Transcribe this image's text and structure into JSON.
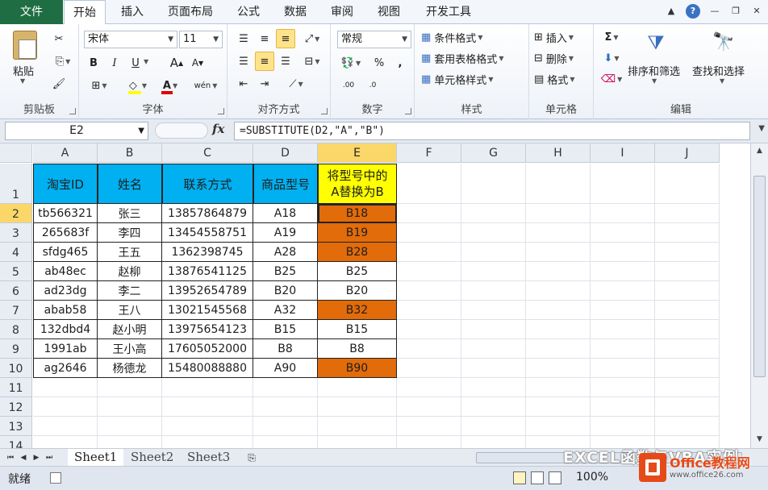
{
  "ribbon_tabs": [
    "文件",
    "开始",
    "插入",
    "页面布局",
    "公式",
    "数据",
    "审阅",
    "视图",
    "开发工具"
  ],
  "active_tab": "开始",
  "clipboard": {
    "paste": "粘贴",
    "label": "剪贴板"
  },
  "font": {
    "name": "宋体",
    "size": "11",
    "label": "字体",
    "bold": "B",
    "italic": "I",
    "underline": "U",
    "grow": "A",
    "shrink": "A",
    "fill_color": "#ffff00",
    "font_color": "#e00000",
    "phonetic": "wén"
  },
  "alignment": {
    "label": "对齐方式"
  },
  "number": {
    "format": "常规",
    "label": "数字",
    "percent": "%",
    "comma": ","
  },
  "styles": {
    "conditional": "条件格式",
    "table": "套用表格格式",
    "cell": "单元格样式",
    "label": "样式"
  },
  "cells": {
    "insert": "插入",
    "delete": "删除",
    "format": "格式",
    "label": "单元格"
  },
  "editing": {
    "sigma": "Σ",
    "sort": "排序和筛选",
    "find": "查找和选择",
    "label": "编辑"
  },
  "formula_bar": {
    "name_box": "E2",
    "fx": "fx",
    "formula": "=SUBSTITUTE(D2,\"A\",\"B\")"
  },
  "columns": [
    "A",
    "B",
    "C",
    "D",
    "E",
    "F",
    "G",
    "H",
    "I",
    "J"
  ],
  "active_col": "E",
  "rows": [
    "1",
    "2",
    "3",
    "4",
    "5",
    "6",
    "7",
    "8",
    "9",
    "10",
    "11",
    "12",
    "13",
    "14"
  ],
  "active_row": "2",
  "table": {
    "headers": [
      "淘宝ID",
      "姓名",
      "联系方式",
      "商品型号"
    ],
    "e_header": [
      "将型号中的",
      "A替换为B"
    ],
    "data": [
      [
        "tb566321",
        "张三",
        "13857864879",
        "A18",
        "B18"
      ],
      [
        "265683f",
        "李四",
        "13454558751",
        "A19",
        "B19"
      ],
      [
        "sfdg465",
        "王五",
        "1362398745",
        "A28",
        "B28"
      ],
      [
        "ab48ec",
        "赵柳",
        "13876541125",
        "B25",
        "B25"
      ],
      [
        "ad23dg",
        "李二",
        "13952654789",
        "B20",
        "B20"
      ],
      [
        "abab58",
        "王八",
        "13021545568",
        "A32",
        "B32"
      ],
      [
        "132dbd4",
        "赵小明",
        "13975654123",
        "B15",
        "B15"
      ],
      [
        "1991ab",
        "王小高",
        "17605052000",
        "B8",
        "B8"
      ],
      [
        "ag2646",
        "杨德龙",
        "15480088880",
        "A90",
        "B90"
      ]
    ],
    "highlighted_rows": [
      0,
      1,
      2,
      5,
      8
    ],
    "highlight_color": "#e26b0a",
    "header_color": "#00b0f0",
    "e_header_color": "#ffff00"
  },
  "sheets": [
    "Sheet1",
    "Sheet2",
    "Sheet3"
  ],
  "active_sheet": "Sheet1",
  "status": {
    "text": "就绪",
    "zoom": "100%"
  },
  "watermark": {
    "text": "EXCEL函数与VBA实例",
    "brand": "Office教程网",
    "site": "www.office26.com"
  }
}
